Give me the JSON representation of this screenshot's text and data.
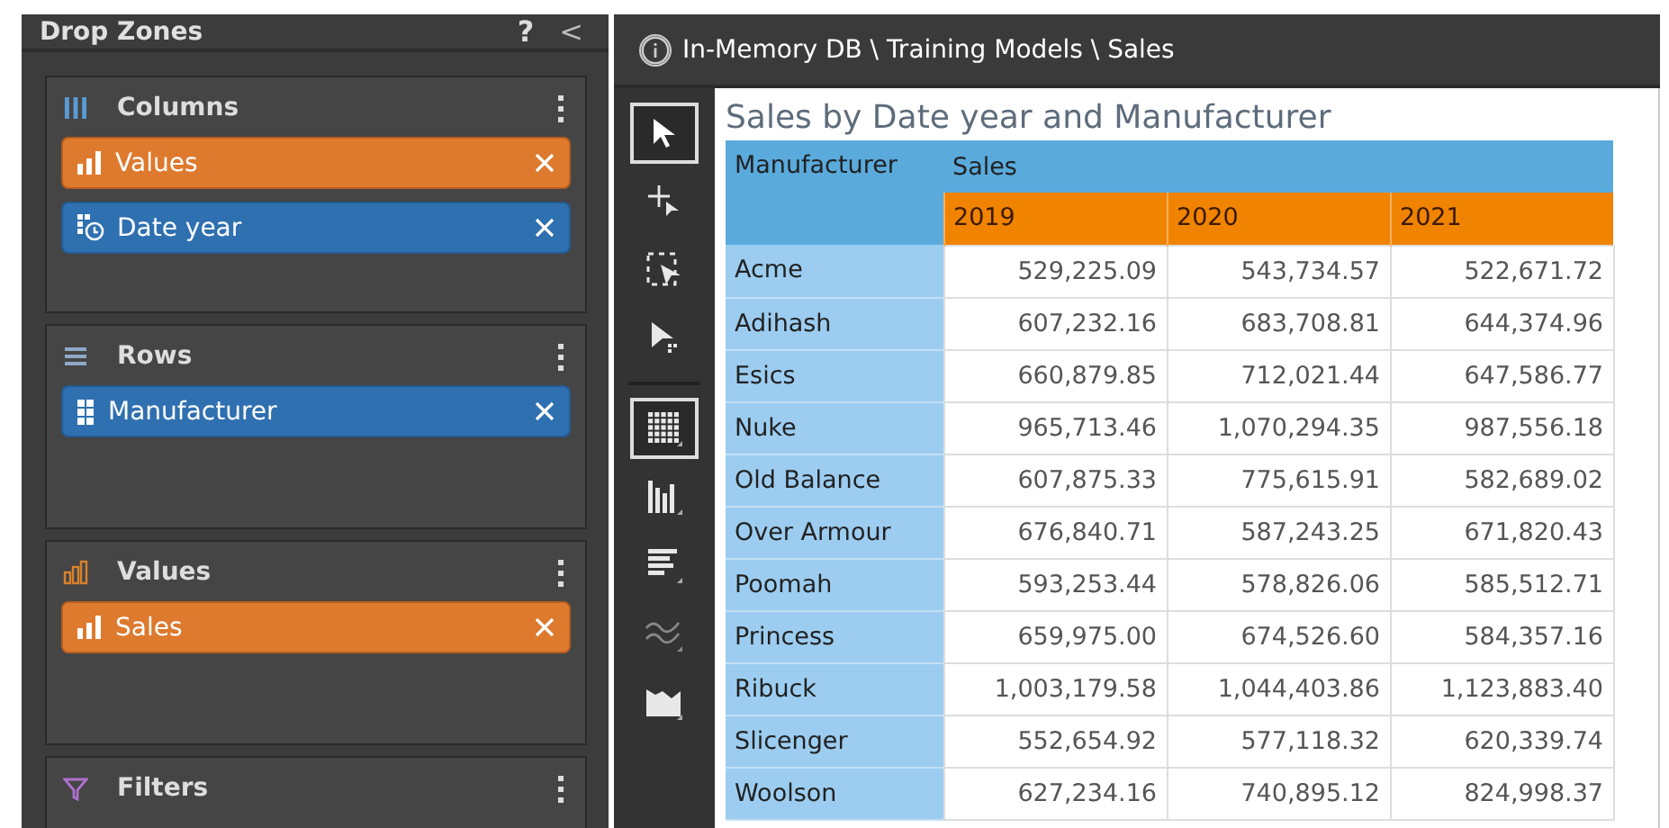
{
  "drop_zones": {
    "title": "Drop Zones",
    "help": "?",
    "collapse": "<",
    "zones": [
      {
        "kind": "columns",
        "label": "Columns",
        "chips": [
          {
            "kind": "measure",
            "label": "Values"
          },
          {
            "kind": "date",
            "label": "Date year"
          }
        ]
      },
      {
        "kind": "rows",
        "label": "Rows",
        "chips": [
          {
            "kind": "attribute",
            "label": "Manufacturer"
          }
        ]
      },
      {
        "kind": "values",
        "label": "Values",
        "chips": [
          {
            "kind": "measure",
            "label": "Sales"
          }
        ]
      },
      {
        "kind": "filters",
        "label": "Filters"
      }
    ]
  },
  "breadcrumb": "In-Memory DB \\ Training Models \\ Sales",
  "tool_groups": [
    [
      {
        "kind": "pointer",
        "selected": true
      },
      {
        "kind": "add",
        "selected": false
      },
      {
        "kind": "marquee",
        "selected": false
      },
      {
        "kind": "drill",
        "selected": false
      }
    ],
    [
      {
        "kind": "grid",
        "selected": true
      },
      {
        "kind": "bars",
        "selected": false
      },
      {
        "kind": "hbars",
        "selected": false
      },
      {
        "kind": "lines",
        "selected": false
      },
      {
        "kind": "area",
        "selected": false
      }
    ]
  ],
  "report": {
    "title": "Sales by Date year and Manufacturer",
    "row_header": "Manufacturer",
    "measure": "Sales",
    "years": [
      "2019",
      "2020",
      "2021"
    ],
    "rows": [
      {
        "name": "Acme",
        "values": [
          "529,225.09",
          "543,734.57",
          "522,671.72"
        ]
      },
      {
        "name": "Adihash",
        "values": [
          "607,232.16",
          "683,708.81",
          "644,374.96"
        ]
      },
      {
        "name": "Esics",
        "values": [
          "660,879.85",
          "712,021.44",
          "647,586.77"
        ]
      },
      {
        "name": "Nuke",
        "values": [
          "965,713.46",
          "1,070,294.35",
          "987,556.18"
        ]
      },
      {
        "name": "Old Balance",
        "values": [
          "607,875.33",
          "775,615.91",
          "582,689.02"
        ]
      },
      {
        "name": "Over Armour",
        "values": [
          "676,840.71",
          "587,243.25",
          "671,820.43"
        ]
      },
      {
        "name": "Poomah",
        "values": [
          "593,253.44",
          "578,826.06",
          "585,512.71"
        ]
      },
      {
        "name": "Princess",
        "values": [
          "659,975.00",
          "674,526.60",
          "584,357.16"
        ]
      },
      {
        "name": "Ribuck",
        "values": [
          "1,003,179.58",
          "1,044,403.86",
          "1,123,883.40"
        ]
      },
      {
        "name": "Slicenger",
        "values": [
          "552,654.92",
          "577,118.32",
          "620,339.74"
        ]
      },
      {
        "name": "Woolson",
        "values": [
          "627,234.16",
          "740,895.12",
          "824,998.37"
        ]
      }
    ]
  }
}
